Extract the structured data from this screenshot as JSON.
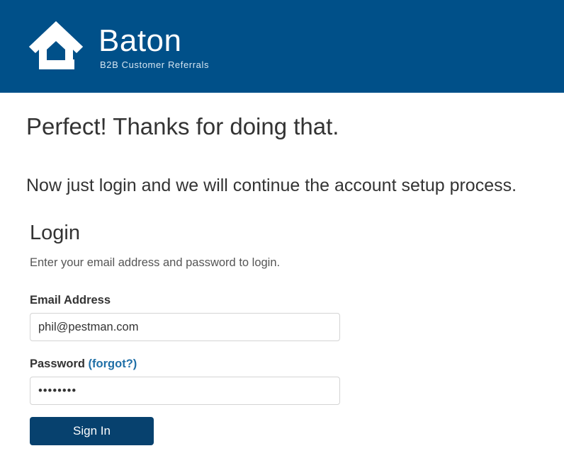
{
  "header": {
    "brand_name": "Baton",
    "brand_tagline": "B2B Customer Referrals",
    "logo_icon": "house-icon",
    "background_color": "#005089"
  },
  "main": {
    "headline": "Perfect! Thanks for doing that.",
    "subline": "Now just login and we will continue the account setup process."
  },
  "login": {
    "title": "Login",
    "description": "Enter your email address and password to login.",
    "email_label": "Email Address",
    "email_value": "phil@pestman.com",
    "password_label": "Password",
    "forgot_link": "(forgot?)",
    "password_value": "password",
    "signin_label": "Sign In",
    "button_color": "#07416e",
    "link_color": "#1f6fa7"
  }
}
